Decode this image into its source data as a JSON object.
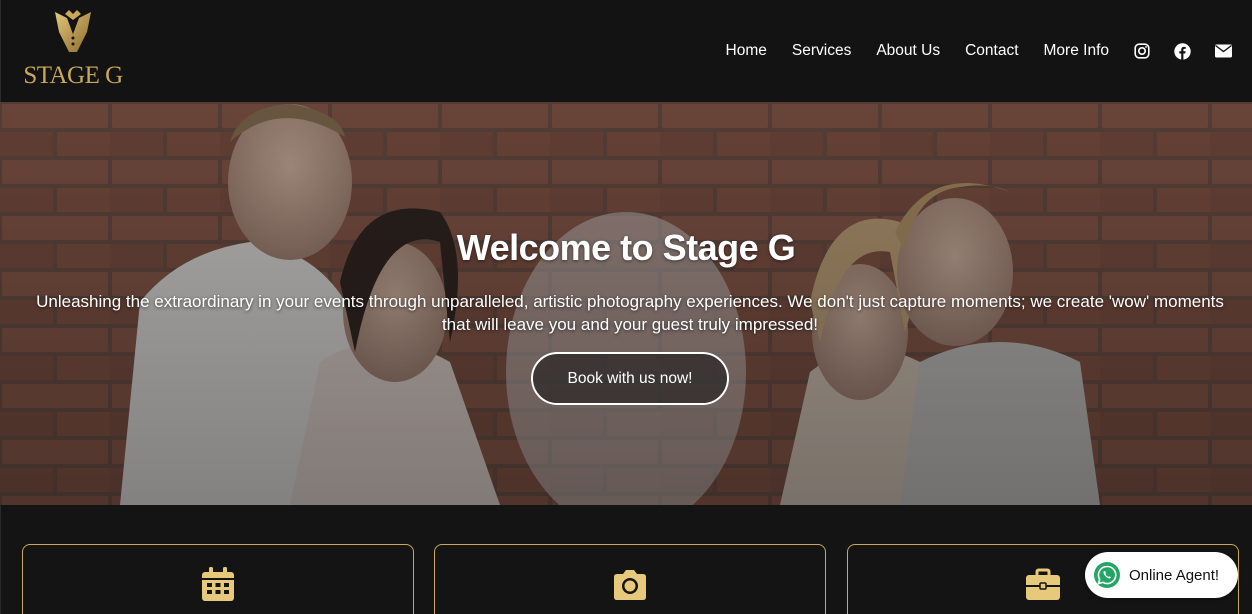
{
  "brand": {
    "name": "STAGE G"
  },
  "nav": {
    "items": [
      "Home",
      "Services",
      "About Us",
      "Contact",
      "More Info"
    ],
    "social": [
      "instagram-icon",
      "facebook-icon",
      "envelope-icon"
    ]
  },
  "hero": {
    "title": "Welcome to Stage G",
    "subtitle": "Unleashing the extraordinary in your events through unparalleled, artistic photography experiences. We don't just capture moments; we create 'wow' moments that will leave you and your guest truly impressed!",
    "cta": "Book with us now!"
  },
  "cards": [
    {
      "icon": "calendar-icon"
    },
    {
      "icon": "camera-icon"
    },
    {
      "icon": "briefcase-icon"
    }
  ],
  "chat": {
    "label": "Online Agent!",
    "icon": "whatsapp-icon"
  },
  "colors": {
    "gold": "#c9a85c",
    "header_bg": "#131313",
    "accent_yellow": "#e6c97a"
  }
}
